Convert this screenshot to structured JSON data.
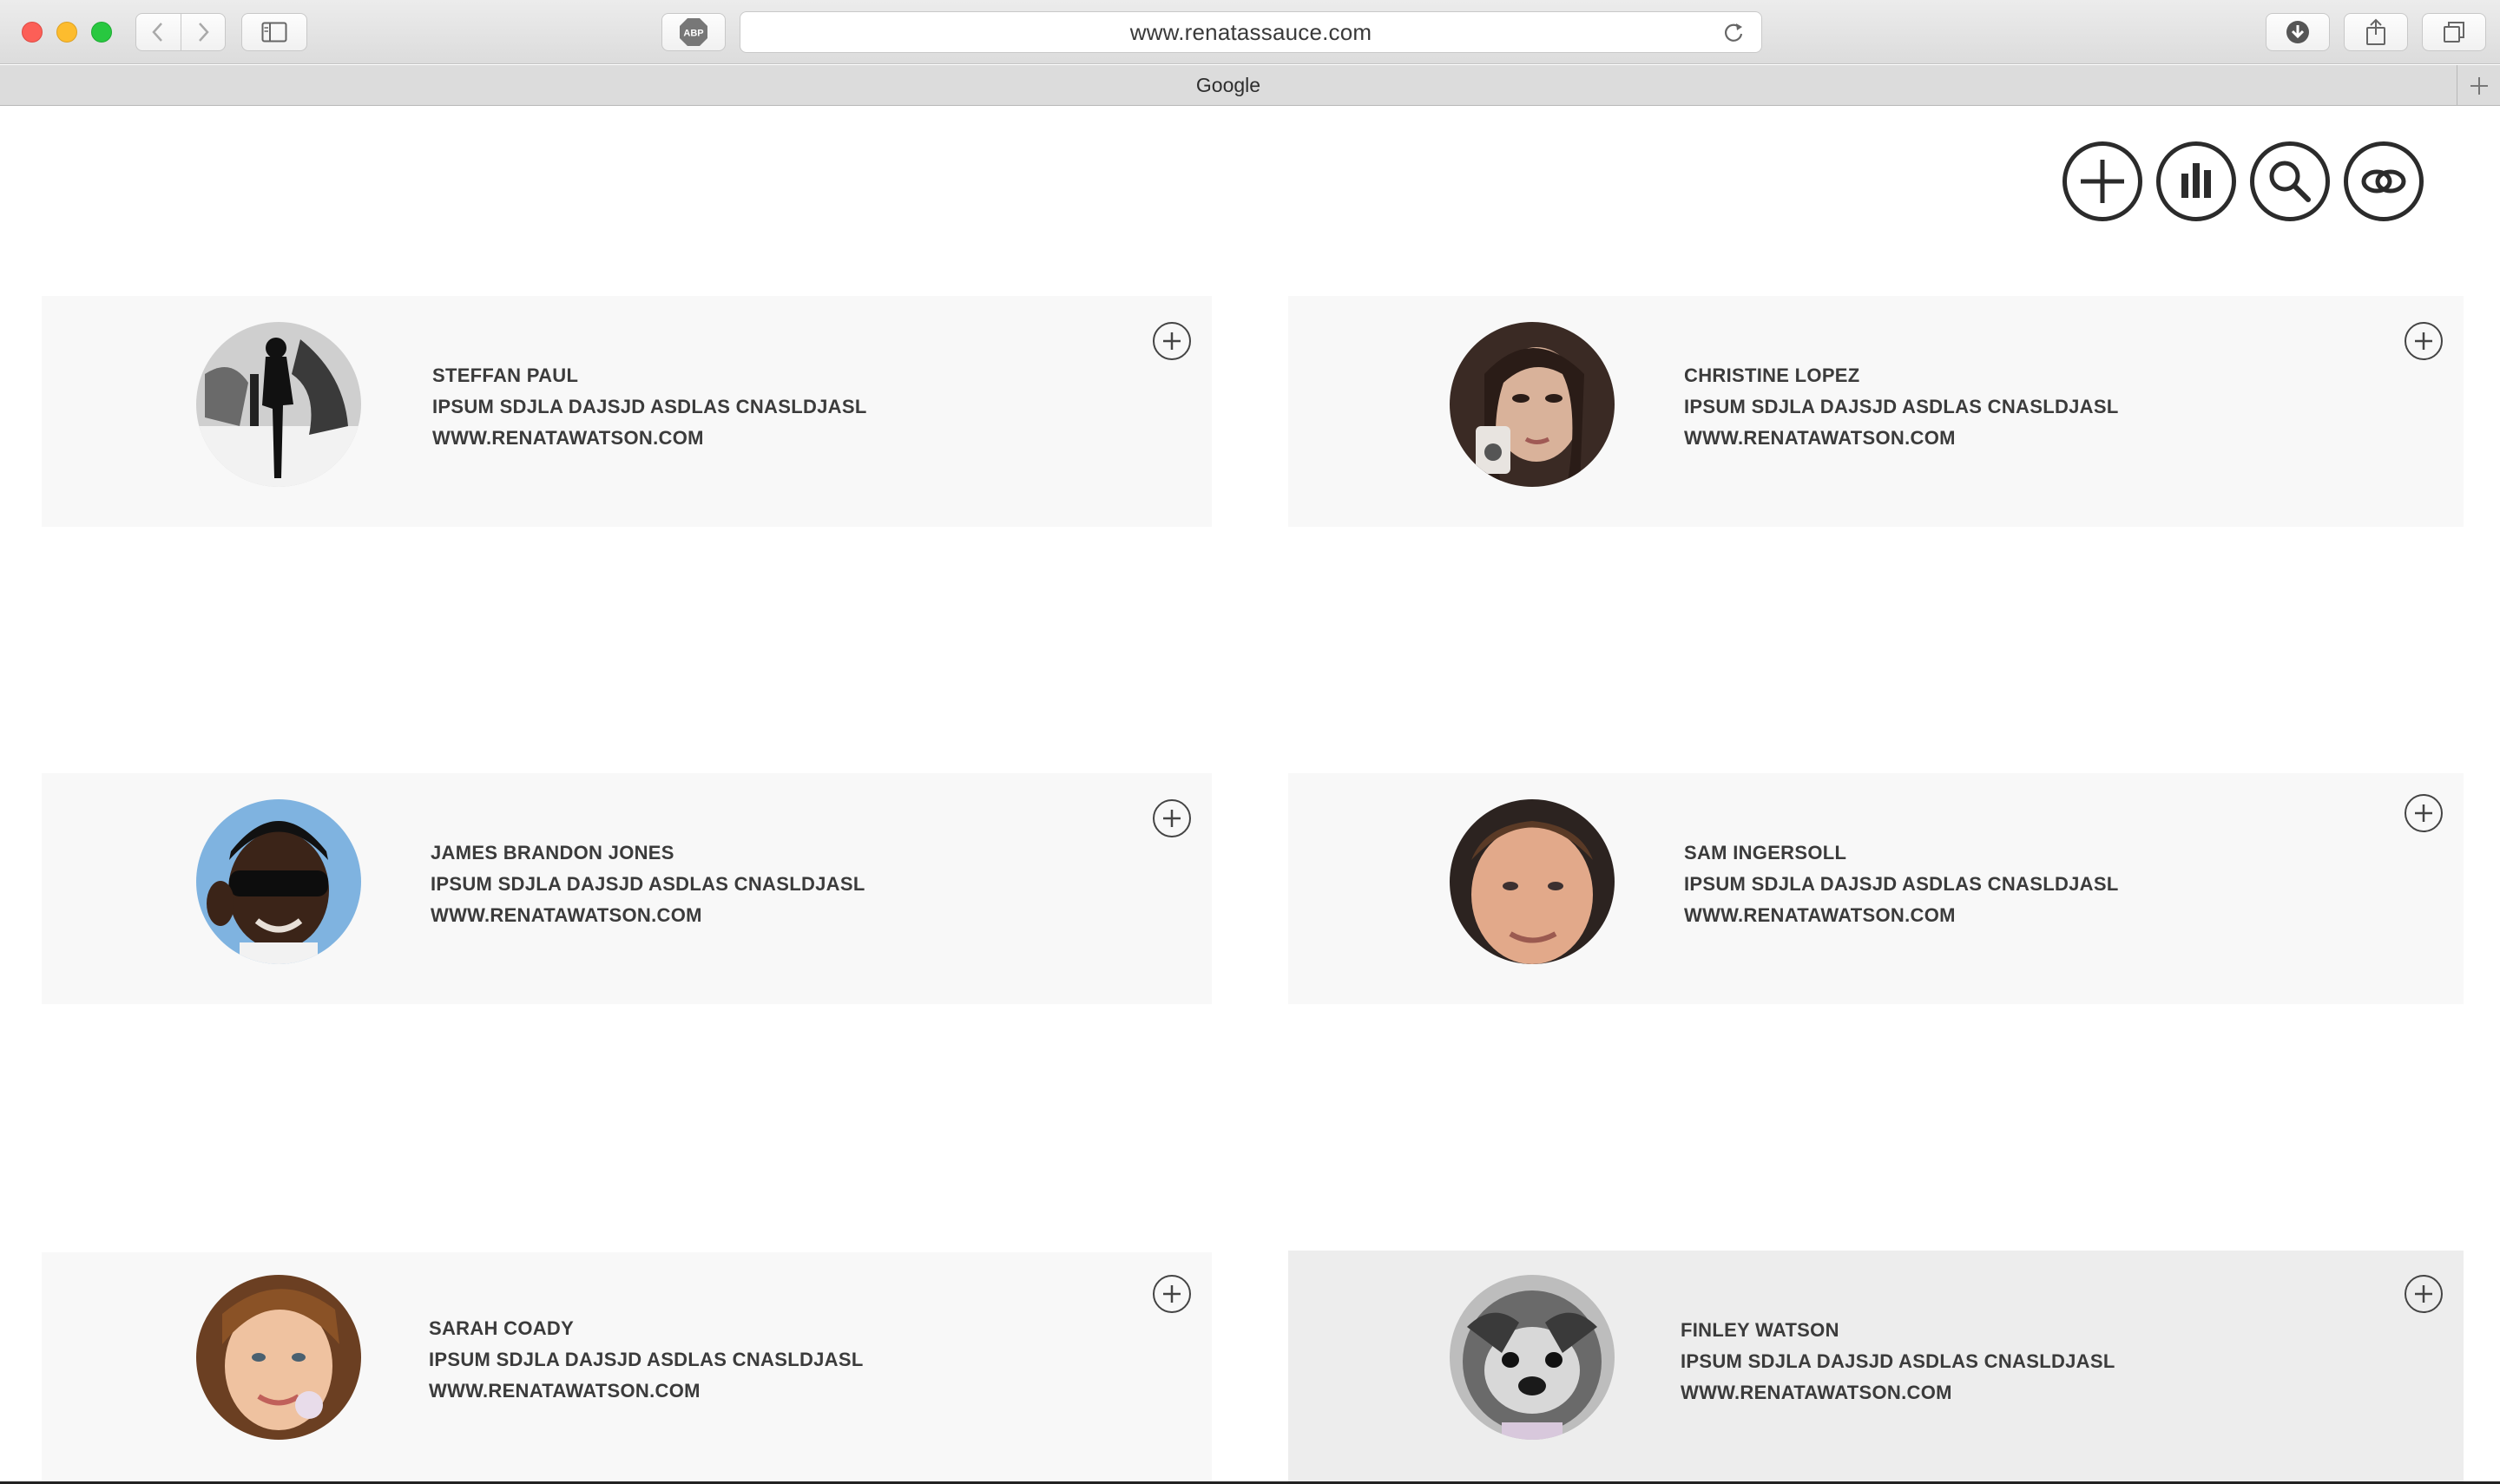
{
  "browser": {
    "url": "www.renatassauce.com",
    "adblock_label": "ABP",
    "tab_title": "Google"
  },
  "toolbar_icons": [
    "add-icon",
    "bar-chart-icon",
    "search-icon",
    "rings-icon"
  ],
  "profiles": [
    {
      "name": "STEFFAN PAUL",
      "description": "IPSUM SDJLA DAJSJD ASDLAS CNASLDJASL",
      "website": "WWW.RENATAWATSON.COM"
    },
    {
      "name": "CHRISTINE LOPEZ",
      "description": "IPSUM SDJLA DAJSJD ASDLAS CNASLDJASL",
      "website": "WWW.RENATAWATSON.COM"
    },
    {
      "name": "JAMES BRANDON JONES",
      "description": "IPSUM SDJLA DAJSJD ASDLAS CNASLDJASL",
      "website": "WWW.RENATAWATSON.COM"
    },
    {
      "name": "SAM INGERSOLL",
      "description": "IPSUM SDJLA DAJSJD ASDLAS CNASLDJASL",
      "website": "WWW.RENATAWATSON.COM"
    },
    {
      "name": "SARAH COADY",
      "description": "IPSUM SDJLA DAJSJD ASDLAS CNASLDJASL",
      "website": "WWW.RENATAWATSON.COM"
    },
    {
      "name": "FINLEY WATSON",
      "description": "IPSUM SDJLA DAJSJD ASDLAS CNASLDJASL",
      "website": "WWW.RENATAWATSON.COM"
    }
  ],
  "colors": {
    "card_bg": "#f8f8f8",
    "card_hover_bg": "#ededed",
    "text": "#3b3b3b",
    "icon_stroke": "#2b2b2b"
  }
}
